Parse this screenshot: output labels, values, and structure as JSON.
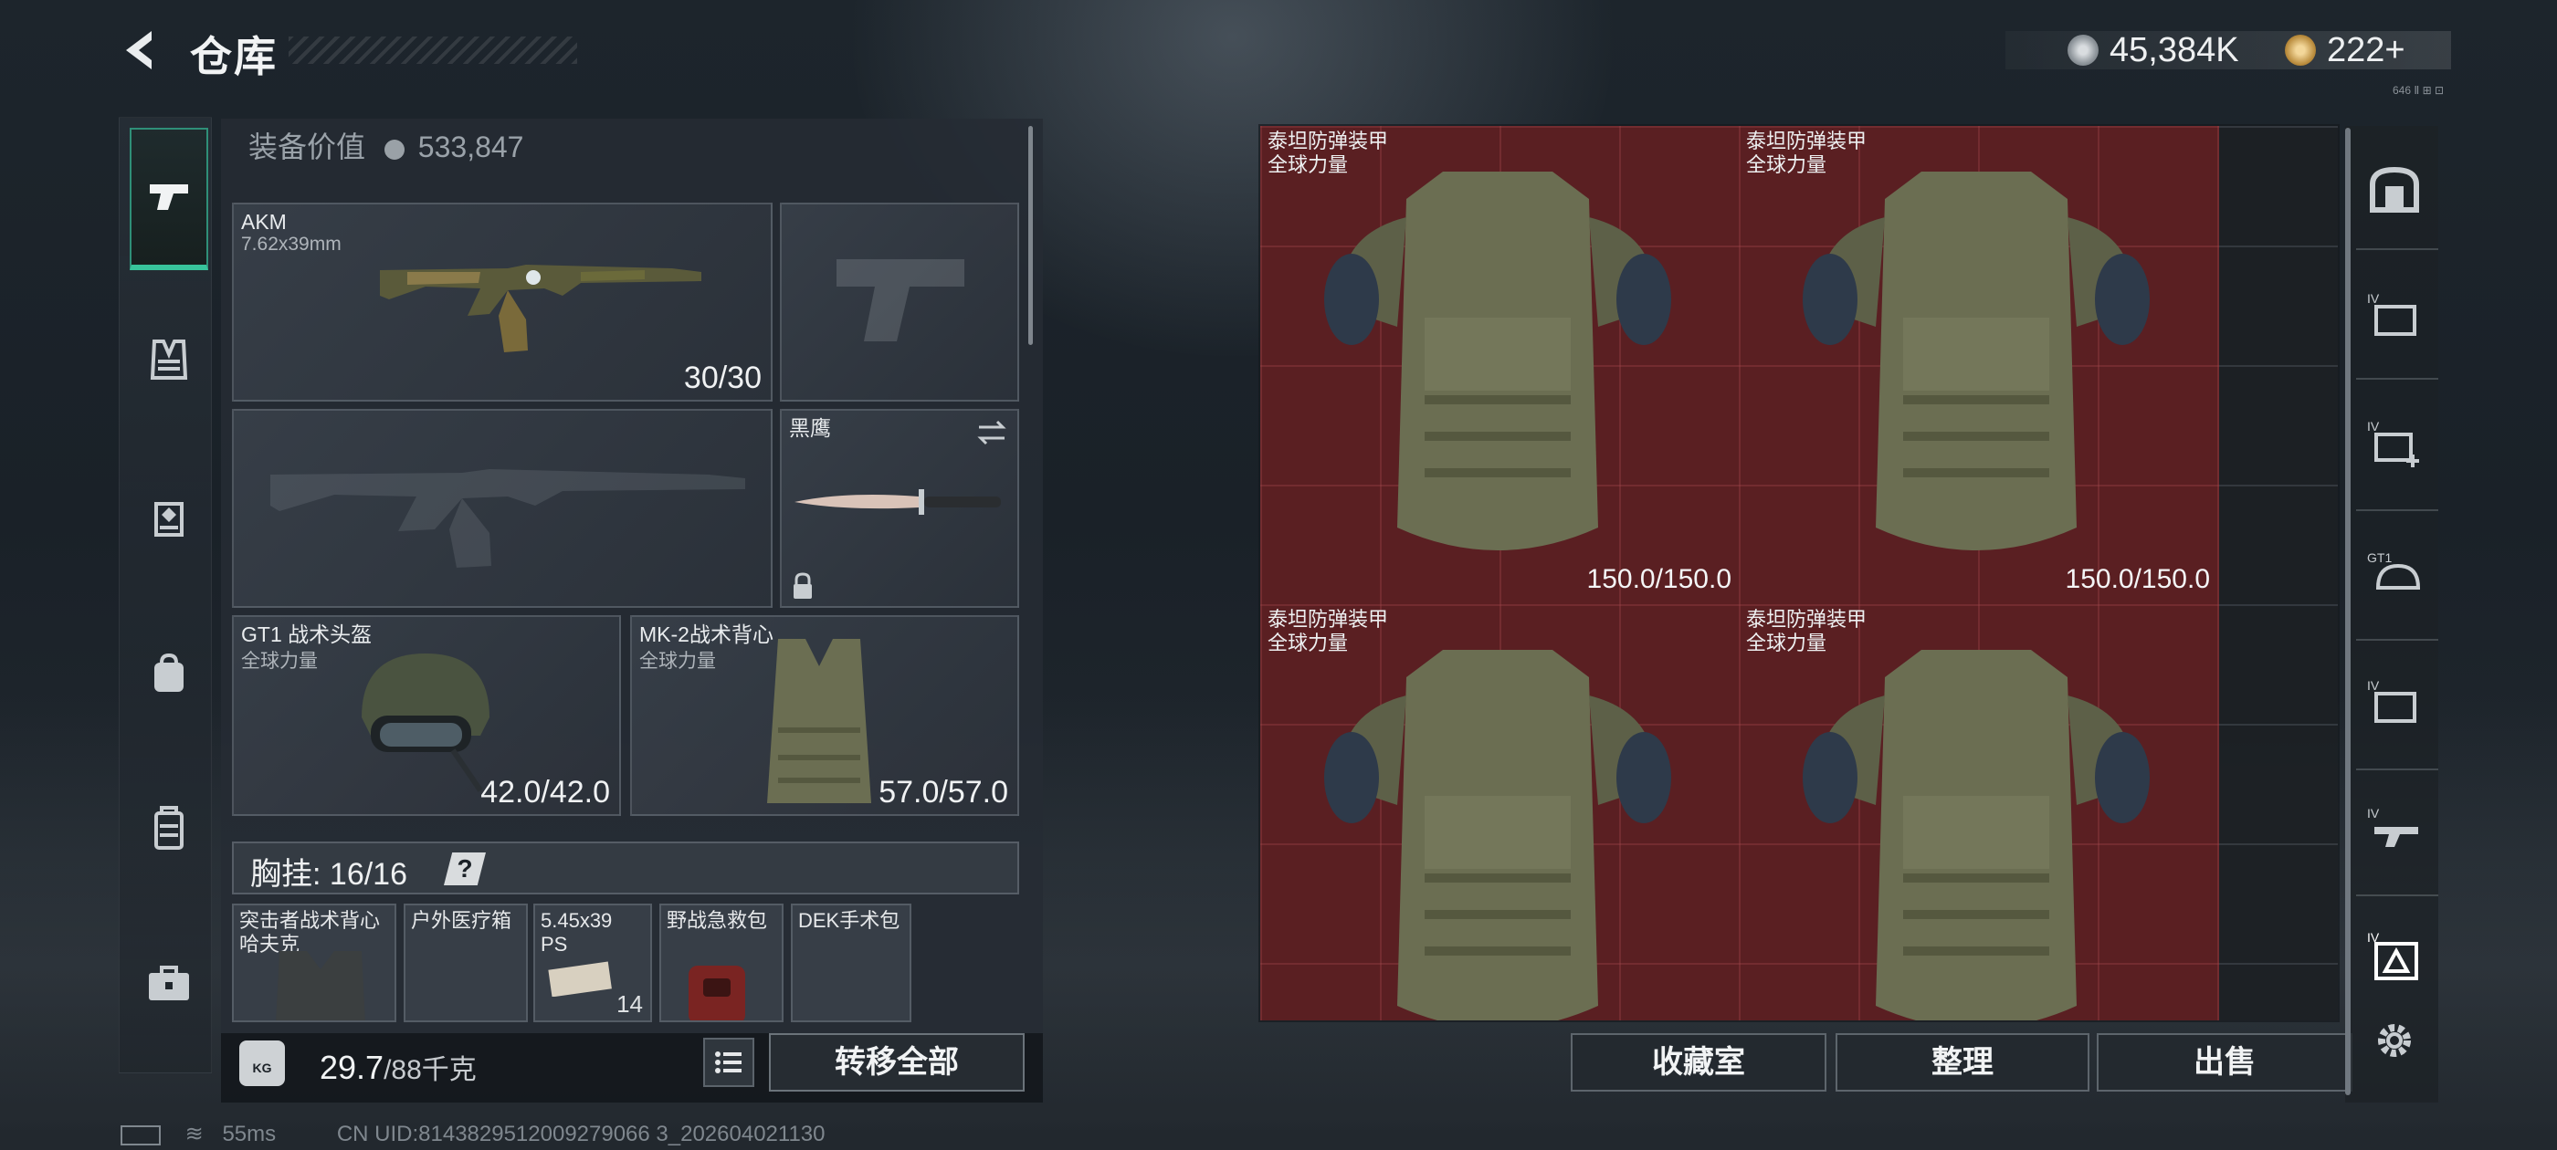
{
  "header": {
    "title": "仓库",
    "currency_main": "45,384K",
    "currency_premium": "222+",
    "corner_mark": "646 Ⅱ ⊞ ⊡"
  },
  "left_nav": [
    {
      "icon": "pistol-icon",
      "active": true
    },
    {
      "icon": "vest-icon"
    },
    {
      "icon": "helmet-icon"
    },
    {
      "icon": "backpack-icon"
    },
    {
      "icon": "container-icon"
    },
    {
      "icon": "toolbox-icon"
    }
  ],
  "equipment": {
    "label": "装备价值",
    "value": "533,847",
    "primary_weapon": {
      "name": "AKM",
      "caliber": "7.62x39mm",
      "ammo": "30/30"
    },
    "melee": {
      "name": "黑鹰"
    },
    "helmet": {
      "name": "GT1 战术头盔",
      "faction": "全球力量",
      "durability": "42.0/42.0"
    },
    "armor": {
      "name": "MK-2战术背心",
      "faction": "全球力量",
      "durability": "57.0/57.0"
    },
    "chest_rig": {
      "label": "胸挂:",
      "capacity": "16/16",
      "help": "?"
    },
    "items": [
      {
        "name": "突击者战术背心\n哈夫克"
      },
      {
        "name": "户外医疗箱"
      },
      {
        "name": "5.45x39\nPS",
        "count": "14"
      },
      {
        "name": "野战急救包"
      },
      {
        "name": "DEK手术包"
      }
    ]
  },
  "weight": {
    "current": "29.7",
    "max": "/88千克",
    "icon_label": "KG"
  },
  "buttons": {
    "transfer_all": "转移全部",
    "collection": "收藏室",
    "organize": "整理",
    "sell": "出售"
  },
  "storage": {
    "items": [
      {
        "name": "泰坦防弹装甲",
        "faction": "全球力量",
        "durability": "150.0/150.0"
      },
      {
        "name": "泰坦防弹装甲",
        "faction": "全球力量",
        "durability": "150.0/150.0"
      },
      {
        "name": "泰坦防弹装甲",
        "faction": "全球力量",
        "durability": ""
      },
      {
        "name": "泰坦防弹装甲",
        "faction": "全球力量",
        "durability": ""
      }
    ]
  },
  "right_nav": [
    {
      "icon": "safe-icon"
    },
    {
      "icon": "storage-iv-icon",
      "tag": "IV"
    },
    {
      "icon": "medical-iv-icon",
      "tag": "IV"
    },
    {
      "icon": "gt1-helmet-icon",
      "tag": "GT1"
    },
    {
      "icon": "storage-iv-icon",
      "tag": "IV"
    },
    {
      "icon": "weapon-iv-icon",
      "tag": "IV"
    },
    {
      "icon": "armor-iv-icon",
      "tag": "IV"
    },
    {
      "icon": "settings-icon"
    }
  ],
  "status": {
    "ping": "55ms",
    "uid": "CN UID:8143829512009279066 3_202604021130"
  }
}
